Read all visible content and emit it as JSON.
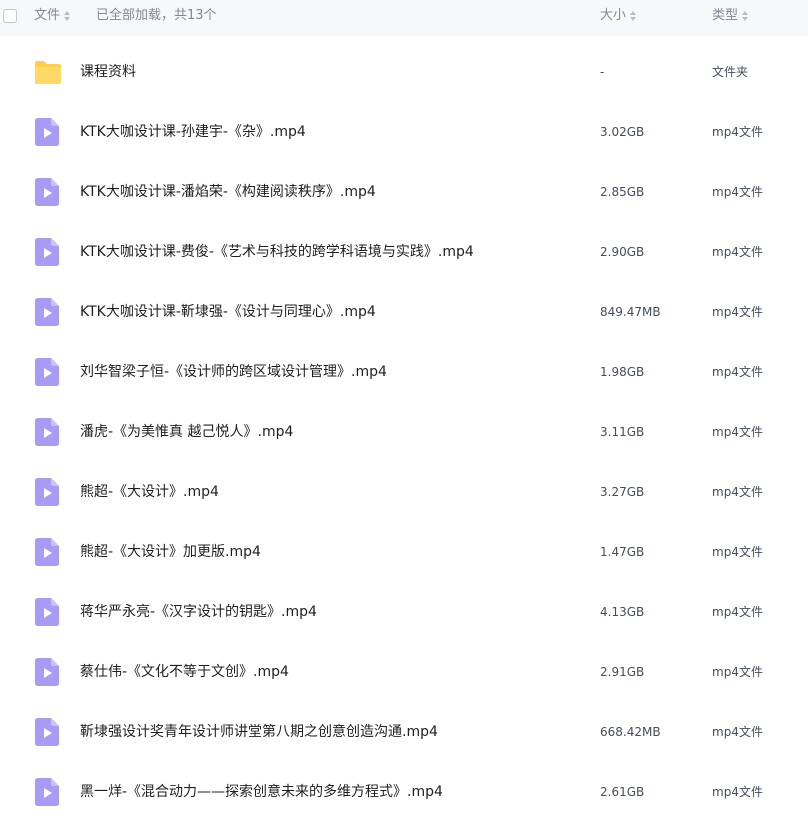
{
  "header": {
    "col_name": "文件",
    "loaded_status": "已全部加载，共13个",
    "col_size": "大小",
    "col_type": "类型"
  },
  "colors": {
    "header_bg": "#f7f8fa",
    "folder": "#ffcf4a",
    "video": "#a79bf6"
  },
  "files": [
    {
      "icon": "folder-icon",
      "name": "课程资料",
      "size": "-",
      "type": "文件夹"
    },
    {
      "icon": "video-file-icon",
      "name": "KTK大咖设计课-孙建宇-《杂》.mp4",
      "size": "3.02GB",
      "type": "mp4文件"
    },
    {
      "icon": "video-file-icon",
      "name": "KTK大咖设计课-潘焰荣-《构建阅读秩序》.mp4",
      "size": "2.85GB",
      "type": "mp4文件"
    },
    {
      "icon": "video-file-icon",
      "name": "KTK大咖设计课-费俊-《艺术与科技的跨学科语境与实践》.mp4",
      "size": "2.90GB",
      "type": "mp4文件"
    },
    {
      "icon": "video-file-icon",
      "name": "KTK大咖设计课-靳埭强-《设计与同理心》.mp4",
      "size": "849.47MB",
      "type": "mp4文件"
    },
    {
      "icon": "video-file-icon",
      "name": "刘华智梁子恒-《设计师的跨区域设计管理》.mp4",
      "size": "1.98GB",
      "type": "mp4文件"
    },
    {
      "icon": "video-file-icon",
      "name": "潘虎-《为美惟真 越己悦人》.mp4",
      "size": "3.11GB",
      "type": "mp4文件"
    },
    {
      "icon": "video-file-icon",
      "name": "熊超-《大设计》.mp4",
      "size": "3.27GB",
      "type": "mp4文件"
    },
    {
      "icon": "video-file-icon",
      "name": "熊超-《大设计》加更版.mp4",
      "size": "1.47GB",
      "type": "mp4文件"
    },
    {
      "icon": "video-file-icon",
      "name": "蒋华严永亮-《汉字设计的钥匙》.mp4",
      "size": "4.13GB",
      "type": "mp4文件"
    },
    {
      "icon": "video-file-icon",
      "name": "蔡仕伟-《文化不等于文创》.mp4",
      "size": "2.91GB",
      "type": "mp4文件"
    },
    {
      "icon": "video-file-icon",
      "name": "靳埭强设计奖青年设计师讲堂第八期之创意创造沟通.mp4",
      "size": "668.42MB",
      "type": "mp4文件"
    },
    {
      "icon": "video-file-icon",
      "name": "黑一烊-《混合动力——探索创意未来的多维方程式》.mp4",
      "size": "2.61GB",
      "type": "mp4文件"
    }
  ]
}
